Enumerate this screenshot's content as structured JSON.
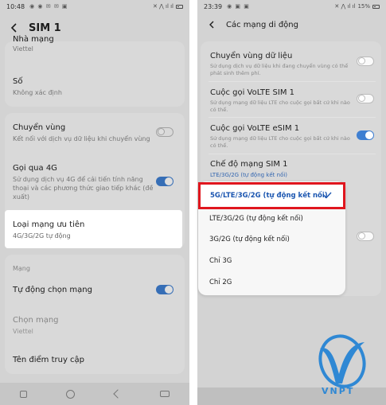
{
  "left": {
    "status": {
      "time": "10:48",
      "icons": "◉ ◉ ✉ ✉ ▣",
      "right_icons": "✕ ⋀ ıl ıl"
    },
    "title": "SIM 1",
    "prefs": {
      "network_name": {
        "title": "Nhà mạng",
        "summary": "Viettel"
      },
      "number": {
        "title": "Số",
        "summary": "Không xác định"
      },
      "roaming": {
        "title": "Chuyển vùng",
        "summary": "Kết nối với dịch vụ dữ liệu khi chuyển vùng",
        "toggle": "off"
      },
      "call_4g": {
        "title": "Gọi qua 4G",
        "summary": "Sử dụng dịch vụ 4G để cải tiến tính năng thoại và các phương thức giao tiếp khác (đề xuất)",
        "toggle": "on"
      },
      "preferred_network": {
        "title": "Loại mạng ưu tiên",
        "summary": "4G/3G/2G tự động"
      },
      "section_network": "Mạng",
      "auto_select": {
        "title": "Tự động chọn mạng",
        "toggle": "on"
      },
      "choose_network": {
        "title": "Chọn mạng",
        "summary": "Viettel"
      },
      "apn": {
        "title": "Tên điểm truy cập"
      }
    }
  },
  "right": {
    "status": {
      "time": "23:39",
      "icons": "◉ ▣ ▣",
      "right_icons": "✕ ⋀ ıl ıl",
      "battery": "15%"
    },
    "title": "Các mạng di động",
    "prefs": {
      "data_roaming": {
        "title": "Chuyển vùng dữ liệu",
        "summary": "Sử dụng dịch vụ dữ liệu khi đang chuyển vùng có thể phát sinh thêm phí.",
        "toggle": "off"
      },
      "volte_sim1": {
        "title": "Cuộc gọi VoLTE SIM 1",
        "summary": "Sử dụng mạng dữ liệu LTE cho cuộc gọi bất cứ khi nào có thể.",
        "toggle": "off"
      },
      "volte_esim1": {
        "title": "Cuộc gọi VoLTE eSIM 1",
        "summary": "Sử dụng mạng dữ liệu LTE cho cuộc gọi bất cứ khi nào có thể.",
        "toggle": "on"
      },
      "network_mode": {
        "title": "Chế độ mạng SIM 1",
        "summary": "LTE/3G/2G (tự động kết nối)"
      }
    },
    "popup": {
      "selected": "5G/LTE/3G/2G (tự động kết nối)",
      "options": [
        "LTE/3G/2G (tự động kết nối)",
        "3G/2G (tự động kết nối)",
        "Chỉ 3G",
        "Chỉ 2G"
      ]
    },
    "logo_text": "VNPT"
  },
  "colors": {
    "accent": "#3f7fd1",
    "highlight_border": "#e0161e",
    "selected_text": "#1a55b0",
    "logo": "#2f88d4"
  }
}
